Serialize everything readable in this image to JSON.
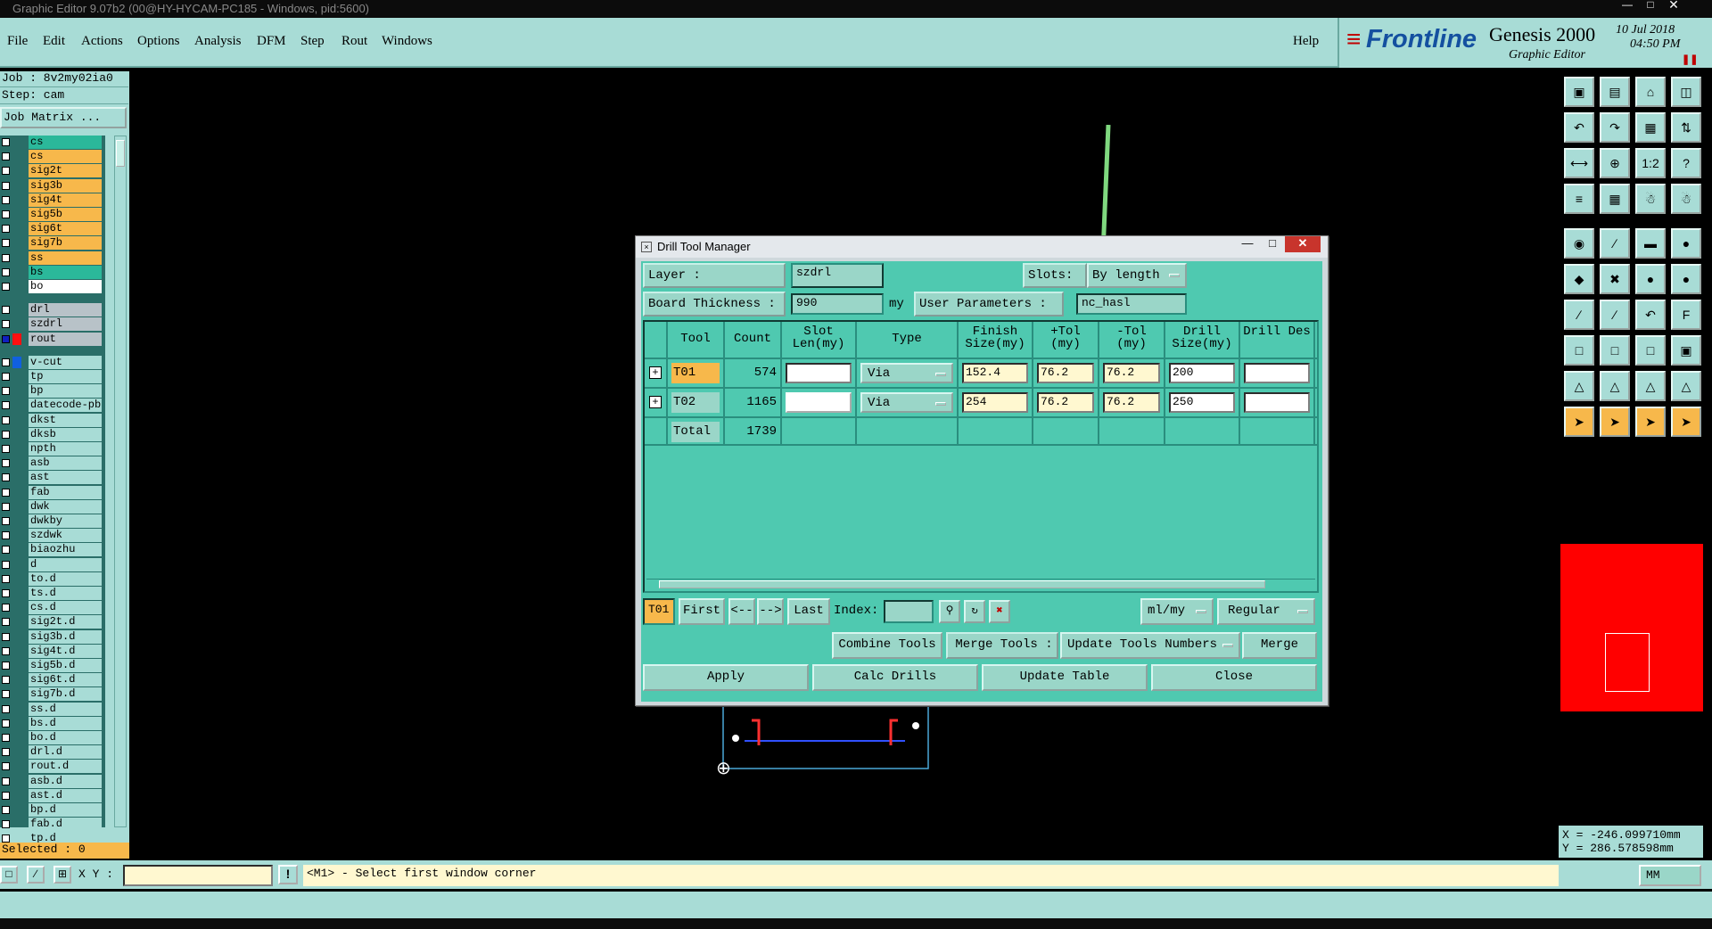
{
  "window_title": "Graphic Editor 9.07b2 (00@HY-HYCAM-PC185 - Windows, pid:5600)",
  "menu": [
    "File",
    "Edit",
    "Actions",
    "Options",
    "Analysis",
    "DFM",
    "Step",
    "Rout",
    "Windows"
  ],
  "help": "Help",
  "brand": {
    "logo": "Frontline",
    "product": "Genesis 2000",
    "subtitle": "Graphic Editor",
    "date": "10 Jul 2018",
    "time": "04:50 PM"
  },
  "left": {
    "job": "Job : 8v2my02ia0",
    "step": "Step: cam",
    "job_matrix": "Job Matrix ...",
    "layers": [
      {
        "name": "cs",
        "style": "gr"
      },
      {
        "name": "cs",
        "style": "or"
      },
      {
        "name": "sig2t",
        "style": "or"
      },
      {
        "name": "sig3b",
        "style": "or"
      },
      {
        "name": "sig4t",
        "style": "or"
      },
      {
        "name": "sig5b",
        "style": "or"
      },
      {
        "name": "sig6t",
        "style": "or"
      },
      {
        "name": "sig7b",
        "style": "or"
      },
      {
        "name": "ss",
        "style": "or"
      },
      {
        "name": "bs",
        "style": "gr"
      },
      {
        "name": "bo",
        "style": "wh"
      },
      {
        "name": "",
        "style": "gap"
      },
      {
        "name": "drl",
        "style": "gy"
      },
      {
        "name": "szdrl",
        "style": "gy"
      },
      {
        "name": "rout",
        "style": "gy"
      },
      {
        "name": "",
        "style": "gap"
      },
      {
        "name": "v-cut",
        "style": "bl"
      },
      {
        "name": "tp",
        "style": "bl"
      },
      {
        "name": "bp",
        "style": "bl"
      },
      {
        "name": "datecode-pbt",
        "style": "bl"
      },
      {
        "name": "dkst",
        "style": "bl"
      },
      {
        "name": "dksb",
        "style": "bl"
      },
      {
        "name": "npth",
        "style": "bl"
      },
      {
        "name": "asb",
        "style": "bl"
      },
      {
        "name": "ast",
        "style": "bl"
      },
      {
        "name": "fab",
        "style": "bl"
      },
      {
        "name": "dwk",
        "style": "bl"
      },
      {
        "name": "dwkby",
        "style": "bl"
      },
      {
        "name": "szdwk",
        "style": "bl"
      },
      {
        "name": "biaozhu",
        "style": "bl"
      },
      {
        "name": "d",
        "style": "bl"
      },
      {
        "name": "to.d",
        "style": "bl"
      },
      {
        "name": "ts.d",
        "style": "bl"
      },
      {
        "name": "cs.d",
        "style": "bl"
      },
      {
        "name": "sig2t.d",
        "style": "bl"
      },
      {
        "name": "sig3b.d",
        "style": "bl"
      },
      {
        "name": "sig4t.d",
        "style": "bl"
      },
      {
        "name": "sig5b.d",
        "style": "bl"
      },
      {
        "name": "sig6t.d",
        "style": "bl"
      },
      {
        "name": "sig7b.d",
        "style": "bl"
      },
      {
        "name": "ss.d",
        "style": "bl"
      },
      {
        "name": "bs.d",
        "style": "bl"
      },
      {
        "name": "bo.d",
        "style": "bl"
      },
      {
        "name": "drl.d",
        "style": "bl"
      },
      {
        "name": "rout.d",
        "style": "bl"
      },
      {
        "name": "asb.d",
        "style": "bl"
      },
      {
        "name": "ast.d",
        "style": "bl"
      },
      {
        "name": "bp.d",
        "style": "bl"
      },
      {
        "name": "fab.d",
        "style": "bl"
      },
      {
        "name": "tp.d",
        "style": "bl"
      }
    ],
    "selected": "Selected : 0"
  },
  "bottom": {
    "xy_label": "X Y :",
    "xy_value": "",
    "message": "<M1> - Select first window corner",
    "units": "MM"
  },
  "coords": {
    "x": "X = -246.099710mm",
    "y": "Y = 286.578598mm"
  },
  "dialog": {
    "title": "Drill Tool Manager",
    "layer_label": "Layer           :",
    "layer_value": "szdrl",
    "slots_label": "Slots:",
    "slots_value": "By length",
    "board_thickness_label": "Board Thickness :",
    "board_thickness_value": "990",
    "board_thickness_unit": "my",
    "user_params_label": "User Parameters :",
    "user_params_value": "nc_hasl",
    "columns": [
      "Tool",
      "Count",
      "Slot Len(my)",
      "Type",
      "Finish Size(my)",
      "+Tol (my)",
      "-Tol (my)",
      "Drill Size(my)",
      "Drill Des"
    ],
    "rows": [
      {
        "tool": "T01",
        "count": "574",
        "slot_len": "",
        "type": "Via",
        "finish": "152.4",
        "ptol": "76.2",
        "mtol": "76.2",
        "drill": "200",
        "des": ""
      },
      {
        "tool": "T02",
        "count": "1165",
        "slot_len": "",
        "type": "Via",
        "finish": "254",
        "ptol": "76.2",
        "mtol": "76.2",
        "drill": "250",
        "des": ""
      }
    ],
    "total_label": "Total",
    "total_count": "1739",
    "current_tool": "T01",
    "first": "First",
    "prev": "<--",
    "next": "-->",
    "last": "Last",
    "index_label": "Index:",
    "index_value": "",
    "units_select": "ml/my",
    "mode_select": "Regular",
    "combine": "Combine Tools",
    "merge_label": "Merge Tools :",
    "update_numbers": "Update Tools Numbers",
    "merge": "Merge",
    "apply": "Apply",
    "calc": "Calc Drills",
    "update_table": "Update Table",
    "close": "Close"
  }
}
